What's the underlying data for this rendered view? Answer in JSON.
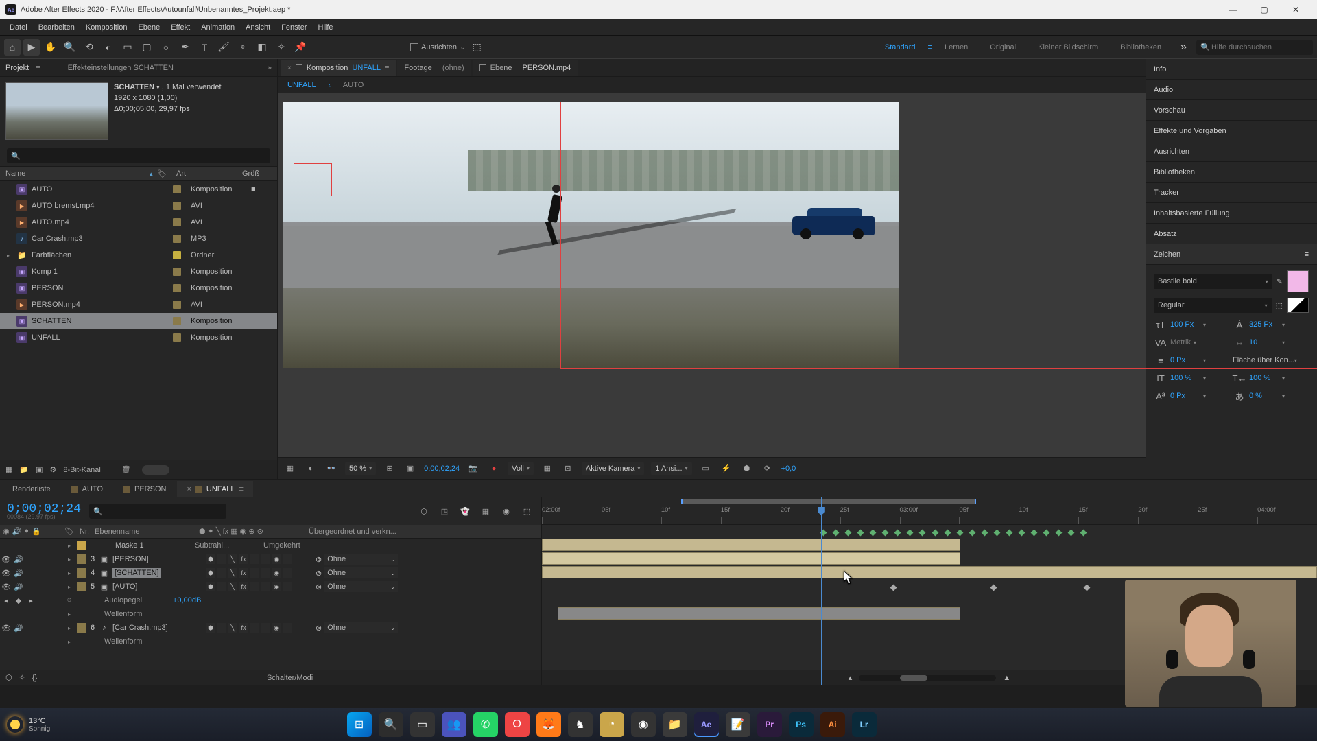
{
  "titlebar": {
    "app": "Adobe After Effects 2020",
    "path": "F:\\After Effects\\Autounfall\\Unbenanntes_Projekt.aep *",
    "min": "—",
    "max": "▢",
    "close": "✕"
  },
  "menu": [
    "Datei",
    "Bearbeiten",
    "Komposition",
    "Ebene",
    "Effekt",
    "Animation",
    "Ansicht",
    "Fenster",
    "Hilfe"
  ],
  "toolbar": {
    "ausrichten": "Ausrichten",
    "workspaces": [
      "Standard",
      "Lernen",
      "Original",
      "Kleiner Bildschirm",
      "Bibliotheken"
    ],
    "active_ws": "Standard",
    "search_placeholder": "Hilfe durchsuchen"
  },
  "project": {
    "tab": "Projekt",
    "effects_label": "Effekteinstellungen",
    "effects_name": "SCHATTEN",
    "thumb_name": "SCHATTEN",
    "thumb_used": ", 1 Mal verwendet",
    "thumb_res": "1920 x 1080 (1,00)",
    "thumb_dur": "Δ0;00;05;00, 29,97 fps",
    "headers": {
      "name": "Name",
      "type": "Art",
      "size": "Größ"
    },
    "items": [
      {
        "name": "AUTO",
        "type": "Komposition",
        "ico": "comp",
        "ext": "■",
        "sw": ""
      },
      {
        "name": "AUTO bremst.mp4",
        "type": "AVI",
        "ico": "avi",
        "sw": ""
      },
      {
        "name": "AUTO.mp4",
        "type": "AVI",
        "ico": "avi",
        "sw": ""
      },
      {
        "name": "Car Crash.mp3",
        "type": "MP3",
        "ico": "mp3",
        "sw": ""
      },
      {
        "name": "Farbflächen",
        "type": "Ordner",
        "ico": "fold",
        "tri": "▸",
        "sw": "y"
      },
      {
        "name": "Komp 1",
        "type": "Komposition",
        "ico": "comp",
        "sw": ""
      },
      {
        "name": "PERSON",
        "type": "Komposition",
        "ico": "comp",
        "sw": ""
      },
      {
        "name": "PERSON.mp4",
        "type": "AVI",
        "ico": "avi",
        "sw": ""
      },
      {
        "name": "SCHATTEN",
        "type": "Komposition",
        "ico": "comp",
        "sel": true,
        "sw": ""
      },
      {
        "name": "UNFALL",
        "type": "Komposition",
        "ico": "comp",
        "sw": ""
      }
    ],
    "footer_depth": "8-Bit-Kanal"
  },
  "viewer": {
    "tabs": [
      {
        "label": "Komposition",
        "accent": "UNFALL",
        "active": true,
        "close": "×"
      },
      {
        "label": "Footage",
        "accent": "(ohne)"
      },
      {
        "label": "Ebene",
        "accent": "PERSON.mp4"
      }
    ],
    "breadcrumb": [
      "UNFALL",
      "AUTO"
    ],
    "breadcrumb_back": "‹",
    "ctrl": {
      "zoom": "50 %",
      "timecode": "0;00;02;24",
      "res": "Voll",
      "camera": "Aktive Kamera",
      "views": "1 Ansi...",
      "exposure": "+0,0"
    }
  },
  "right_panels": {
    "items": [
      "Info",
      "Audio",
      "Vorschau",
      "Effekte und Vorgaben",
      "Ausrichten",
      "Bibliotheken",
      "Tracker",
      "Inhaltsbasierte Füllung",
      "Absatz",
      "Zeichen"
    ],
    "char": {
      "title": "Zeichen",
      "font": "Bastile bold",
      "style": "Regular",
      "size": "100 Px",
      "leading": "325 Px",
      "kern": "Metrik",
      "track": "10",
      "stroke": "0 Px",
      "fill_label": "Fläche über Kon...",
      "vscale": "100 %",
      "hscale": "100 %",
      "baseline": "0 Px",
      "tsume": "0 %"
    }
  },
  "timeline": {
    "tabs": [
      "Renderliste",
      "AUTO",
      "PERSON",
      "UNFALL"
    ],
    "active_tab": 3,
    "timecode": "0;00;02;24",
    "frame_sub": "00084 (29.97 fps)",
    "col_layer": "Ebenenname",
    "col_parent": "Übergeordnet und verkn...",
    "col_nr": "Nr.",
    "ruler_labels": [
      "02:00f",
      "05f",
      "10f",
      "15f",
      "20f",
      "25f",
      "03:00f",
      "05f",
      "10f",
      "15f",
      "20f",
      "25f",
      "04:00f"
    ],
    "mask_label": "Maske 1",
    "subtrah": "Subtrahi...",
    "umgek": "Umgekehrt",
    "layers": [
      {
        "idx": "3",
        "name": "[PERSON]",
        "sw": "b",
        "parent": "Ohne",
        "ico": "▣"
      },
      {
        "idx": "4",
        "name": "[SCHATTEN]",
        "sw": "",
        "parent": "Ohne",
        "sel": true,
        "ico": "▣"
      },
      {
        "idx": "5",
        "name": "[AUTO]",
        "sw": "",
        "parent": "Ohne",
        "ico": "▣"
      },
      {
        "sub": true,
        "name": "Audiopegel",
        "val": "+0,00dB",
        "kfprev": "◆"
      },
      {
        "sub": true,
        "name": "Wellenform"
      },
      {
        "idx": "6",
        "name": "[Car Crash.mp3]",
        "sw": "m",
        "parent": "Ohne",
        "ico": "♪"
      },
      {
        "sub": true,
        "name": "Wellenform"
      }
    ],
    "parent_none": "Ohne",
    "footer": "Schalter/Modi"
  },
  "taskbar": {
    "temp": "13°C",
    "cond": "Sonnig"
  }
}
